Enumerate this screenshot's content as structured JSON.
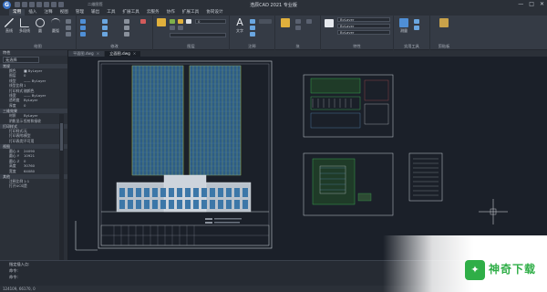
{
  "app": {
    "title": "浩辰CAD 2021 专业版",
    "logo_letter": "G",
    "brand_color": "#3b73c6"
  },
  "window_controls": {
    "minimize": "—",
    "maximize": "□",
    "close": "✕"
  },
  "quick_search": "二维图签",
  "menu": {
    "items": [
      "常用",
      "插入",
      "注释",
      "视图",
      "管理",
      "输出",
      "工具",
      "扩展工具",
      "云服务",
      "协作",
      "扩展工具",
      "协同设计"
    ]
  },
  "ribbon": {
    "groups": [
      {
        "label": "绘图",
        "buttons": [
          "直线",
          "多段线",
          "圆",
          "圆弧"
        ]
      },
      {
        "label": "修改",
        "buttons": []
      },
      {
        "label": "图层",
        "buttons": []
      },
      {
        "label": "注释",
        "buttons": [
          "文字"
        ]
      },
      {
        "label": "块",
        "buttons": []
      },
      {
        "label": "特性",
        "buttons": []
      },
      {
        "label": "实用工具",
        "buttons": [
          "测量"
        ]
      },
      {
        "label": "剪贴板",
        "buttons": []
      }
    ],
    "layer_combo": "0",
    "bylayer_combo": "ByLayer"
  },
  "tabs": [
    {
      "label": "平面图.dwg",
      "active": false
    },
    {
      "label": "立面图.dwg",
      "active": true
    }
  ],
  "panel": {
    "title": "特性",
    "selection": "无选择",
    "sections": [
      {
        "title": "常规",
        "rows": [
          {
            "k": "颜色",
            "v": "■ ByLayer"
          },
          {
            "k": "图层",
            "v": "0"
          },
          {
            "k": "线型",
            "v": "—— ByLayer"
          },
          {
            "k": "线型比例",
            "v": "1"
          },
          {
            "k": "打印样式",
            "v": "随颜色"
          },
          {
            "k": "线宽",
            "v": "—— ByLayer"
          },
          {
            "k": "透明度",
            "v": "ByLayer"
          },
          {
            "k": "厚度",
            "v": "0"
          }
        ]
      },
      {
        "title": "三维效果",
        "rows": [
          {
            "k": "材质",
            "v": "ByLayer"
          },
          {
            "k": "阴影显示",
            "v": "投射和接收"
          }
        ]
      },
      {
        "title": "打印样式",
        "rows": [
          {
            "k": "打印样式表",
            "v": "无"
          },
          {
            "k": "打印表附着到",
            "v": "模型"
          },
          {
            "k": "打印表类型",
            "v": "不可用"
          }
        ]
      },
      {
        "title": "视图",
        "rows": [
          {
            "k": "圆心 X",
            "v": "24090"
          },
          {
            "k": "圆心 Y",
            "v": "10921"
          },
          {
            "k": "圆心 Z",
            "v": "0"
          },
          {
            "k": "高度",
            "v": "30760"
          },
          {
            "k": "宽度",
            "v": "64080"
          }
        ]
      },
      {
        "title": "其他",
        "rows": [
          {
            "k": "注释比例",
            "v": "1:1"
          },
          {
            "k": "打开UCS图标",
            "v": "是"
          }
        ]
      }
    ]
  },
  "command": {
    "history": [
      "指定插入点:",
      "命令:",
      "命令:"
    ]
  },
  "status": {
    "coords": "124109, 66170, 0"
  },
  "watermark": {
    "text": "神奇下载",
    "color": "#2fae47"
  },
  "colors": {
    "canvas_bg": "#1b2029",
    "building_glass": "#3c77a8",
    "building_frame": "#9fb34a",
    "drawing_border": "#c8cdd4",
    "site_green": "#3fbf55"
  }
}
